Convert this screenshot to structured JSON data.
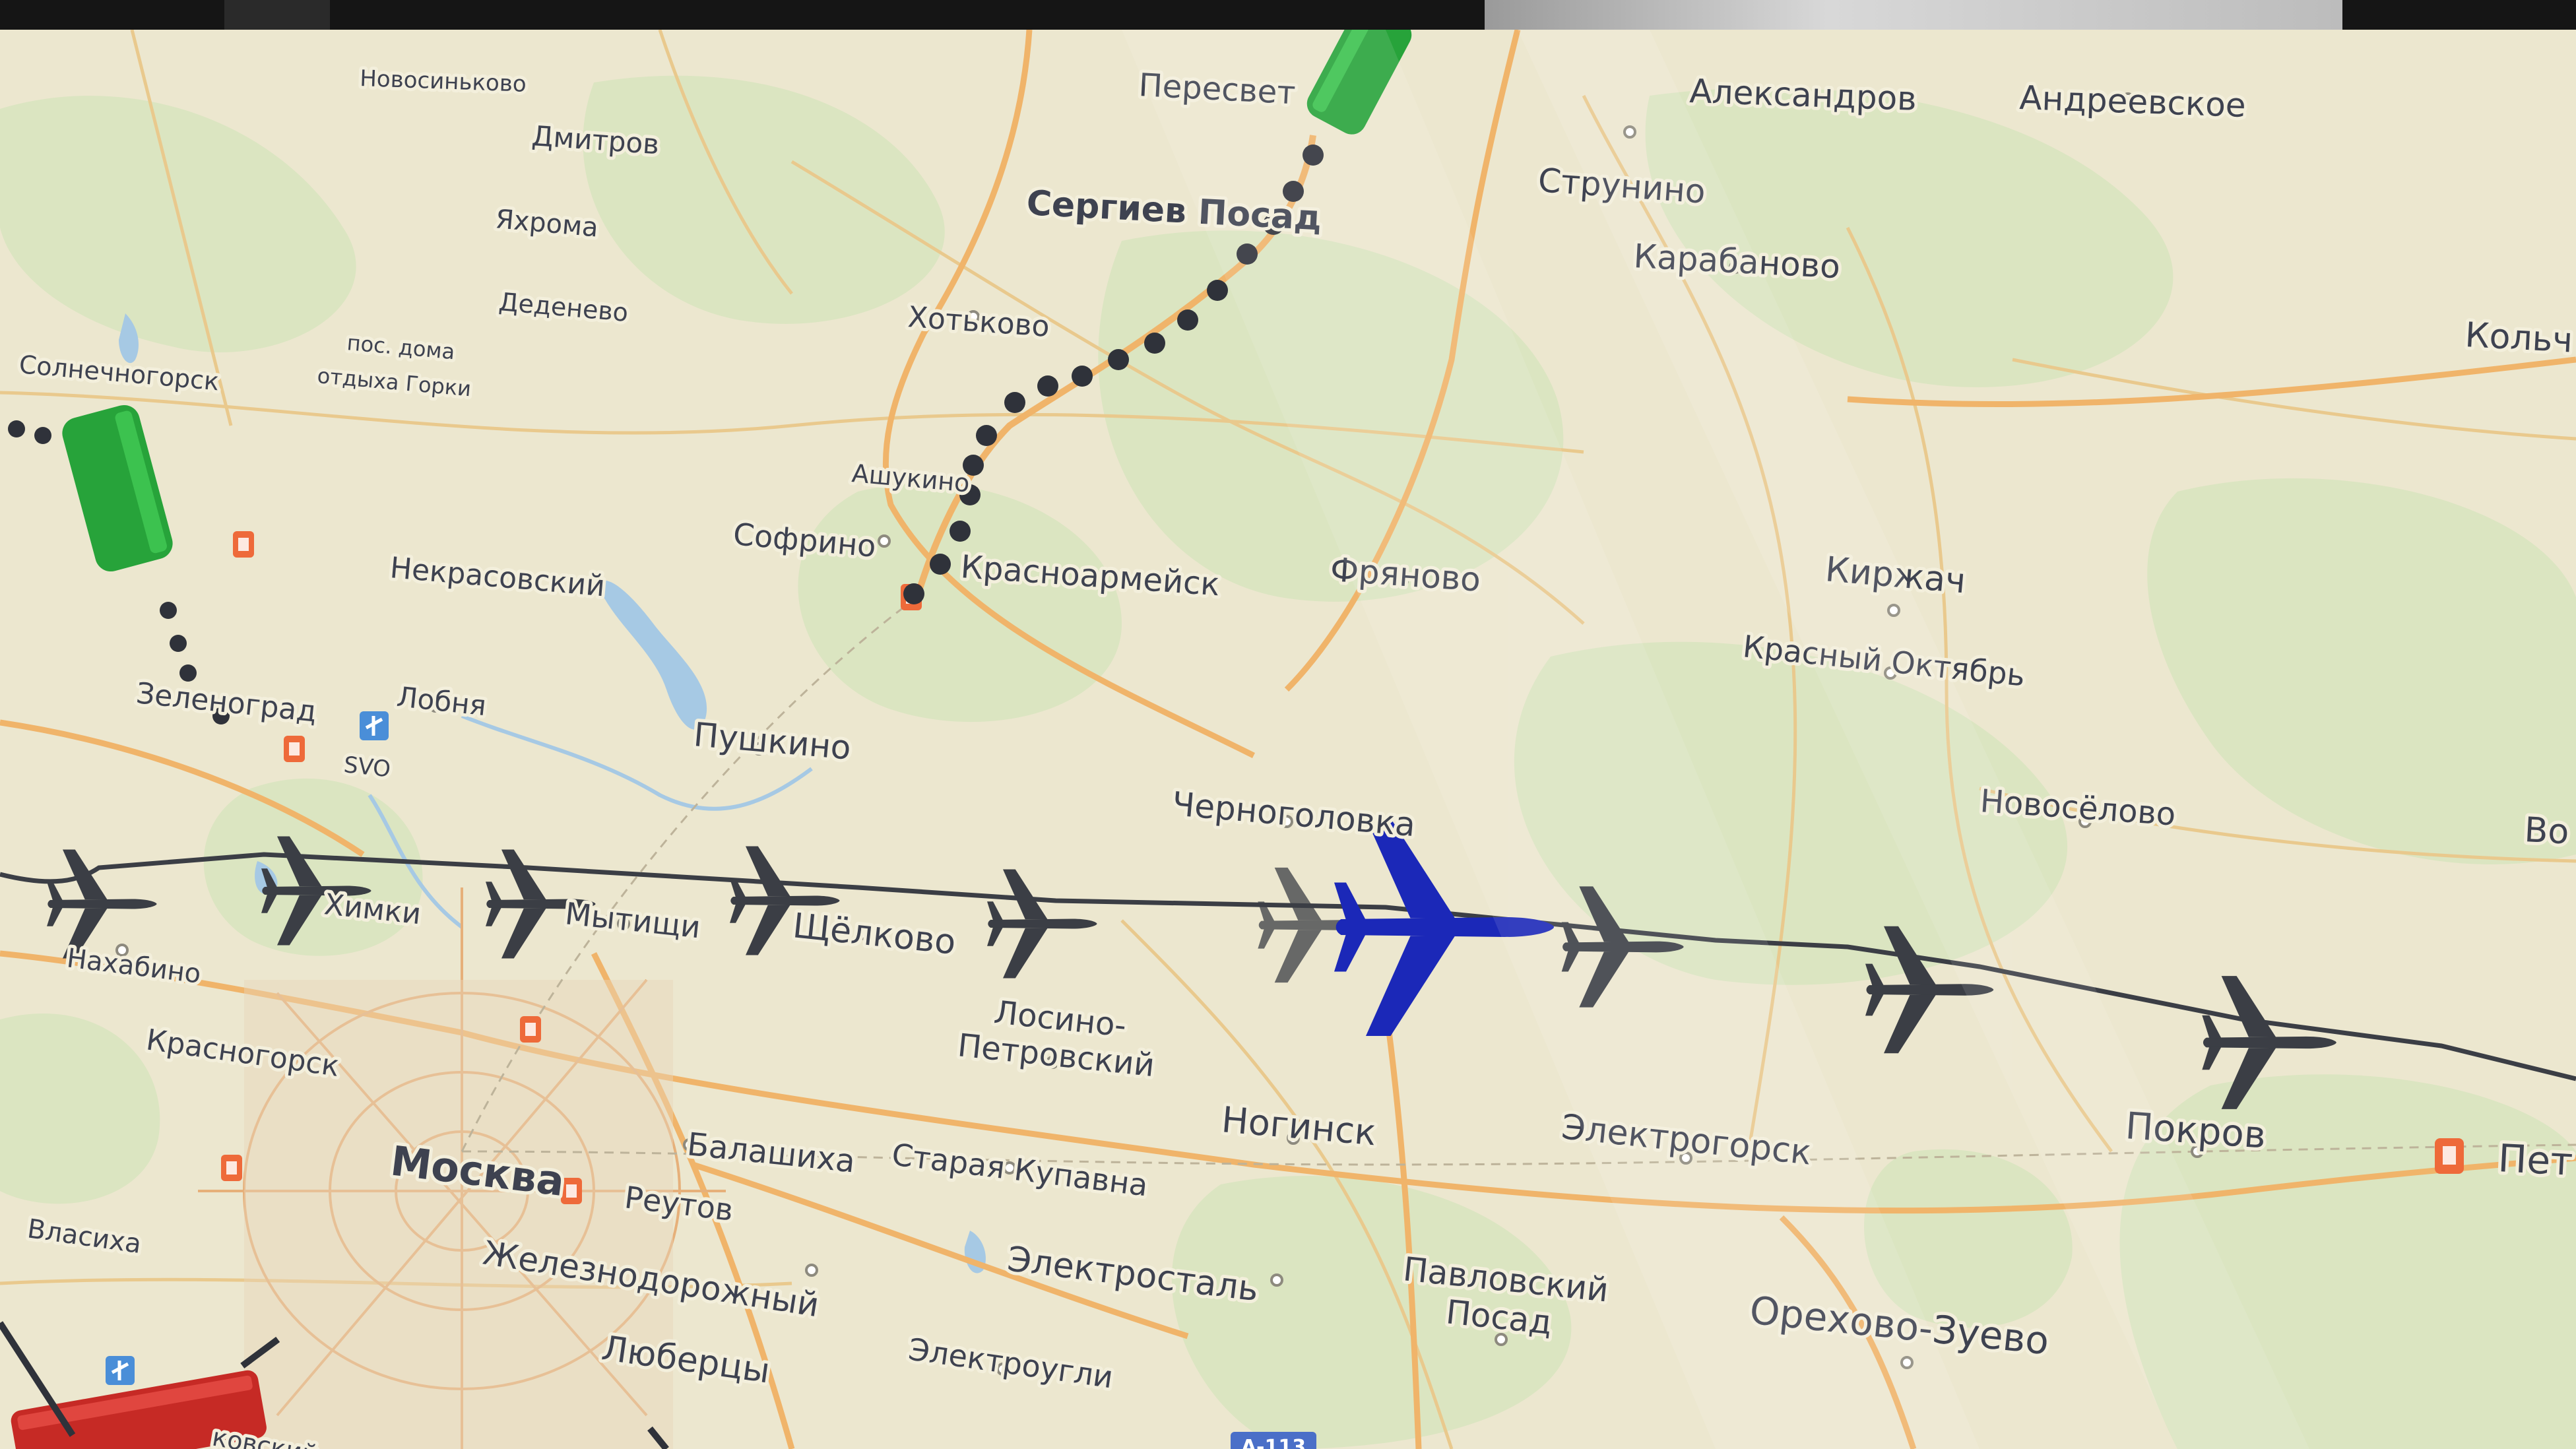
{
  "map": {
    "region_labels": {
      "novosinkovo": "Новосиньково",
      "peresvet": "Пересвет",
      "aleksandrov": "Александров",
      "andreevskoe": "Андреевское",
      "dmitrov": "Дмитров",
      "strunino": "Струнино",
      "sergiev_posad": "Сергиев Посад",
      "yakhroma": "Яхрома",
      "karabanovo": "Карабаново",
      "dedenevo": "Деденево",
      "kolchugino": "Кольч",
      "khotkovo": "Хотьково",
      "gorki_1": "пос. дома",
      "gorki_2": "отдыха Горки",
      "solnechnogorsk": "Солнечногорск",
      "ashukino": "Ашукино",
      "sofrino": "Софрино",
      "nekrasovsky": "Некрасовский",
      "krasnoarmeysk": "Красноармейск",
      "fryanovo": "Фряново",
      "kirzhach": "Киржач",
      "krasny_oktyabr": "Красный Октябрь",
      "zelenograd": "Зеленоград",
      "lobnya": "Лобня",
      "pushkino": "Пушкино",
      "svo": "SVO",
      "novoselovo": "Новосёлово",
      "chernogolovka": "Черноголовка",
      "vo": "Во",
      "khimki": "Химки",
      "mytishchi": "Мытищи",
      "shchyolkovo": "Щёлково",
      "nakhabino": "Нахабино",
      "losino_1": "Лосино-",
      "losino_2": "Петровский",
      "krasnogorsk": "Красногорск",
      "noginsk": "Ногинск",
      "elektrogorsk": "Электрогорск",
      "pokrov": "Покров",
      "pet": "Пет",
      "moskva": "Москва",
      "balashikha": "Балашиха",
      "staraya_kupavna": "Старая Купавна",
      "reutov": "Реутов",
      "vlasikha": "Власиха",
      "zheleznodorozhny": "Железнодорожный",
      "elektrostal": "Электросталь",
      "pavlovsky_1": "Павловский",
      "pavlovsky_2": "Посад",
      "orekhovo_zuevo": "Орехово-Зуево",
      "lyubertsy": "Люберцы",
      "elektrougli": "Электроугли",
      "kovskiy": "ковский",
      "road_a113": "А-113"
    },
    "colors": {
      "background": "#ece7cf",
      "forest": "#dbe5c1",
      "major_road": "#f0b46a",
      "minor_road": "#e9c98d",
      "water": "#a6c9e4",
      "flight_path": "#3b3e45",
      "plane_markers": "#3b3e45",
      "active_plane": "#1b28b8",
      "train_dots": "#2f323a",
      "train_vehicle": "#27a33a",
      "bus_vehicle": "#c62a25",
      "station_marker": "#ee6a3a"
    },
    "icons": {
      "airplane": "airplane-icon",
      "active_airplane": "active-airplane-icon",
      "train": "train-icon",
      "bus": "bus-icon",
      "rail_station": "rail-station-icon",
      "airport": "airport-icon"
    }
  }
}
